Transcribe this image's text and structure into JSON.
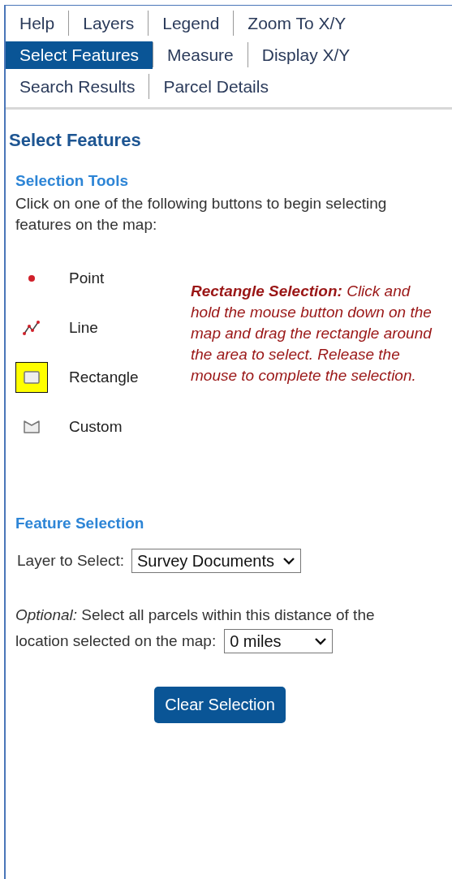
{
  "tab_rows": [
    [
      {
        "label": "Help",
        "selected": false
      },
      {
        "label": "Layers",
        "selected": false
      },
      {
        "label": "Legend",
        "selected": false
      },
      {
        "label": "Zoom To X/Y",
        "selected": false
      }
    ],
    [
      {
        "label": "Select Features",
        "selected": true
      },
      {
        "label": "Measure",
        "selected": false
      },
      {
        "label": "Display X/Y",
        "selected": false
      }
    ],
    [
      {
        "label": "Search Results",
        "selected": false
      },
      {
        "label": "Parcel Details",
        "selected": false
      }
    ]
  ],
  "panel_title": "Select Features",
  "selection_tools": {
    "heading": "Selection Tools",
    "intro": "Click on one of the following buttons to begin selecting features on the map:",
    "tools": [
      {
        "kind": "point",
        "label": "Point",
        "selected": false
      },
      {
        "kind": "line",
        "label": "Line",
        "selected": false
      },
      {
        "kind": "rectangle",
        "label": "Rectangle",
        "selected": true
      },
      {
        "kind": "custom",
        "label": "Custom",
        "selected": false
      }
    ],
    "description": "**Rectangle Selection:** Click and hold the mouse button down on the map and drag the rectangle around the area to select. Release the mouse to complete the selection."
  },
  "feature_selection": {
    "heading": "Feature Selection",
    "layer_label": "Layer to Select:",
    "layer_value": "Survey Documents",
    "distance_text_lines": [
      "*Optional:* Select all parcels within this distance of the",
      "location selected on the map:"
    ],
    "distance_value": "0 miles"
  },
  "clear_button": "Clear Selection"
}
